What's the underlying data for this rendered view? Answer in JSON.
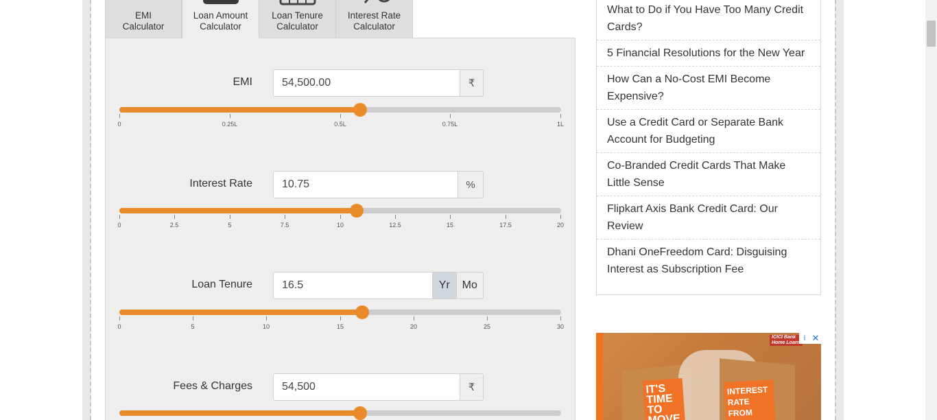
{
  "tabs": [
    {
      "line1": "EMI",
      "line2": "Calculator",
      "active": false
    },
    {
      "line1": "Loan Amount",
      "line2": "Calculator",
      "active": true
    },
    {
      "line1": "Loan Tenure",
      "line2": "Calculator",
      "active": false
    },
    {
      "line1": "Interest Rate",
      "line2": "Calculator",
      "active": false
    }
  ],
  "calculator": {
    "emi": {
      "label": "EMI",
      "value": "54,500.00",
      "unit": "₹",
      "slider_fraction": 0.545,
      "ticks": [
        "0",
        "0.25L",
        "0.5L",
        "0.75L",
        "1L"
      ]
    },
    "interest": {
      "label": "Interest Rate",
      "value": "10.75",
      "unit": "%",
      "slider_fraction": 0.5375,
      "ticks": [
        "0",
        "2.5",
        "5",
        "7.5",
        "10",
        "12.5",
        "15",
        "17.5",
        "20"
      ]
    },
    "tenure": {
      "label": "Loan Tenure",
      "value": "16.5",
      "unit_yr": "Yr",
      "unit_mo": "Mo",
      "slider_fraction": 0.55,
      "ticks": [
        "0",
        "5",
        "10",
        "15",
        "20",
        "25",
        "30"
      ]
    },
    "fees": {
      "label": "Fees & Charges",
      "value": "54,500",
      "unit": "₹",
      "slider_fraction": 0.545
    }
  },
  "sidebar": {
    "articles": [
      "What to Do if You Have Too Many Credit Cards?",
      "5 Financial Resolutions for the New Year",
      "How Can a No-Cost EMI Become Expensive?",
      "Use a Credit Card or Separate Bank Account for Budgeting",
      "Co-Branded Credit Cards That Make Little Sense",
      "Flipkart Axis Bank Credit Card: Our Review",
      "Dhani OneFreedom Card: Disguising Interest as Subscription Fee"
    ]
  },
  "ad": {
    "brand": "ICICI Bank Home Loans",
    "card1_text": "IT'S TIME TO MOVE",
    "card2_text": "INTEREST RATE FROM",
    "info_icon": "i",
    "close_icon": "✕"
  },
  "colors": {
    "accent": "#e98b2a",
    "panel_bg": "#eeeeee",
    "track": "#cccccc"
  }
}
